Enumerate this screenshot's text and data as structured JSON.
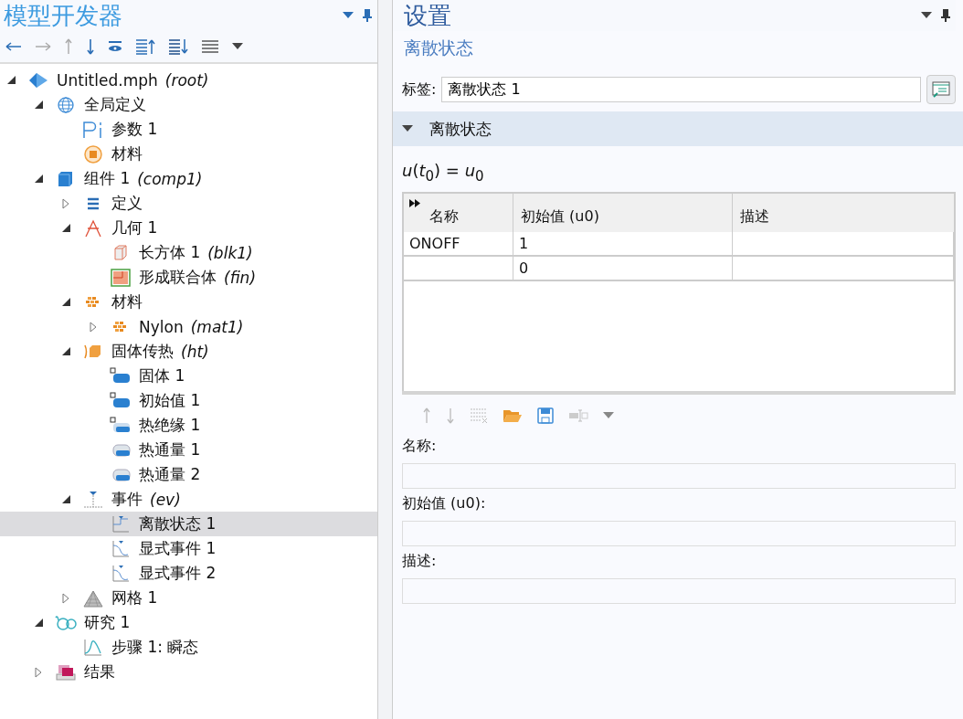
{
  "model_builder": {
    "title": "模型开发器",
    "tree": [
      {
        "label": "Untitled.mph",
        "tag": "(root)",
        "kind": "model",
        "expanded": true,
        "selected": false,
        "children": [
          {
            "label": "全局定义",
            "kind": "globe",
            "expanded": true,
            "selected": false,
            "children": [
              {
                "label": "参数 1",
                "kind": "param",
                "selected": false
              },
              {
                "label": "材料",
                "kind": "material-ring",
                "selected": false
              }
            ]
          },
          {
            "label": "组件 1",
            "tag": "(comp1)",
            "kind": "component",
            "expanded": true,
            "selected": false,
            "children": [
              {
                "label": "定义",
                "kind": "definitions",
                "expanded": false,
                "selected": false
              },
              {
                "label": "几何 1",
                "kind": "geometry",
                "expanded": true,
                "selected": false,
                "children": [
                  {
                    "label": "长方体 1",
                    "tag": "(blk1)",
                    "kind": "block",
                    "selected": false
                  },
                  {
                    "label": "形成联合体",
                    "tag": "(fin)",
                    "kind": "union",
                    "selected": false
                  }
                ]
              },
              {
                "label": "材料",
                "kind": "material",
                "expanded": true,
                "selected": false,
                "children": [
                  {
                    "label": "Nylon",
                    "tag": "(mat1)",
                    "kind": "material",
                    "expanded": false,
                    "selected": false
                  }
                ]
              },
              {
                "label": "固体传热",
                "tag": "(ht)",
                "kind": "heat",
                "expanded": true,
                "selected": false,
                "children": [
                  {
                    "label": "固体 1",
                    "kind": "domain",
                    "selected": false
                  },
                  {
                    "label": "初始值 1",
                    "kind": "domain",
                    "selected": false
                  },
                  {
                    "label": "热绝缘 1",
                    "kind": "boundary-d",
                    "selected": false
                  },
                  {
                    "label": "热通量 1",
                    "kind": "boundary",
                    "selected": false
                  },
                  {
                    "label": "热通量 2",
                    "kind": "boundary",
                    "selected": false
                  }
                ]
              },
              {
                "label": "事件",
                "tag": "(ev)",
                "kind": "event",
                "expanded": true,
                "selected": false,
                "children": [
                  {
                    "label": "离散状态 1",
                    "kind": "event-step",
                    "selected": true
                  },
                  {
                    "label": "显式事件 1",
                    "kind": "event-curve",
                    "selected": false
                  },
                  {
                    "label": "显式事件 2",
                    "kind": "event-curve",
                    "selected": false
                  }
                ]
              },
              {
                "label": "网格 1",
                "kind": "mesh",
                "expanded": false,
                "selected": false
              }
            ]
          },
          {
            "label": "研究 1",
            "kind": "study",
            "expanded": true,
            "selected": false,
            "children": [
              {
                "label": "步骤 1: 瞬态",
                "kind": "study-step",
                "selected": false
              }
            ]
          },
          {
            "label": "结果",
            "kind": "results",
            "expanded": false,
            "selected": false
          }
        ]
      }
    ]
  },
  "settings": {
    "title": "设置",
    "subtitle": "离散状态",
    "label_caption": "标签:",
    "label_value": "离散状态 1",
    "section": {
      "title": "离散状态",
      "expanded": true
    },
    "formula": "*u*(*t*$_{0}$) = *u*$_{0}$",
    "table": {
      "columns": [
        "名称",
        "初始值 (u0)",
        "描述"
      ],
      "rows": [
        [
          "ONOFF",
          "1",
          ""
        ],
        [
          "",
          "0",
          ""
        ]
      ]
    },
    "fields": [
      {
        "label": "名称:"
      },
      {
        "label": "初始值 (u0):"
      },
      {
        "label": "描述:"
      }
    ]
  }
}
